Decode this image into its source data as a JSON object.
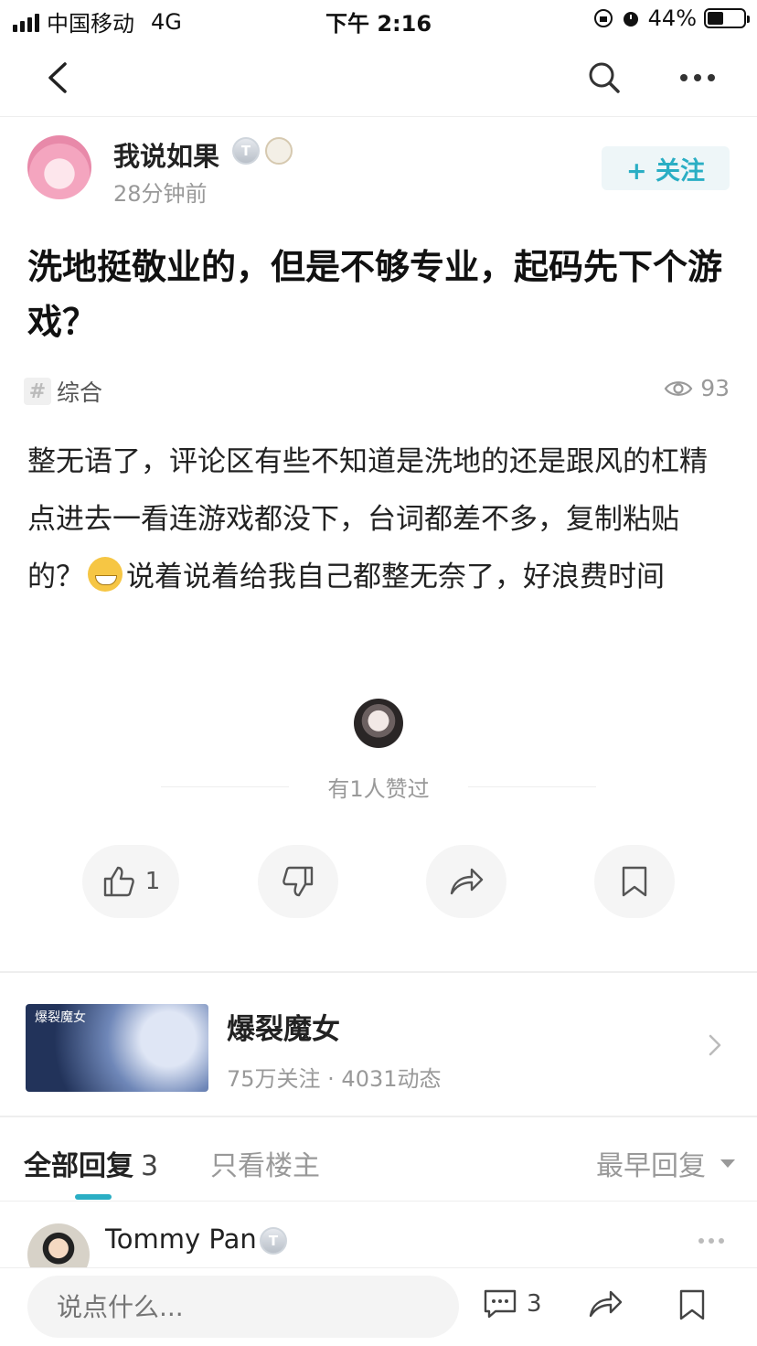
{
  "status_bar": {
    "carrier": "中国移动",
    "network": "4G",
    "time": "下午 2:16",
    "battery_percent": "44%",
    "battery_level": 0.44
  },
  "author": {
    "name": "我说如果",
    "time": "28分钟前",
    "badge_level": "T3",
    "follow_label": "+ 关注"
  },
  "post": {
    "title": "洗地挺敬业的，但是不够专业，起码先下个游戏？",
    "tag": "综合",
    "views": "93",
    "body_part1": "整无语了，评论区有些不知道是洗地的还是跟风的杠精点进去一看连游戏都没下，台词都差不多，复制粘贴的？",
    "body_part2": "说着说着给我自己都整无奈了，好浪费时间",
    "emoji": "sweat-smile-emoji"
  },
  "likes": {
    "text": "有1人赞过"
  },
  "actions": {
    "like_count": "1"
  },
  "game": {
    "title": "爆裂魔女",
    "stats": "75万关注 · 4031动态",
    "cover_text": "爆裂魔女"
  },
  "tabs": {
    "all_label": "全部回复",
    "all_count": "3",
    "owner_label": "只看楼主",
    "sort_label": "最早回复"
  },
  "comment": {
    "name": "Tommy Pan",
    "badge_level": "T3"
  },
  "bottom_bar": {
    "placeholder": "说点什么...",
    "comment_count": "3"
  },
  "colors": {
    "accent": "#2aaec4",
    "muted_text": "#999999",
    "button_bg": "#f5f5f5"
  }
}
